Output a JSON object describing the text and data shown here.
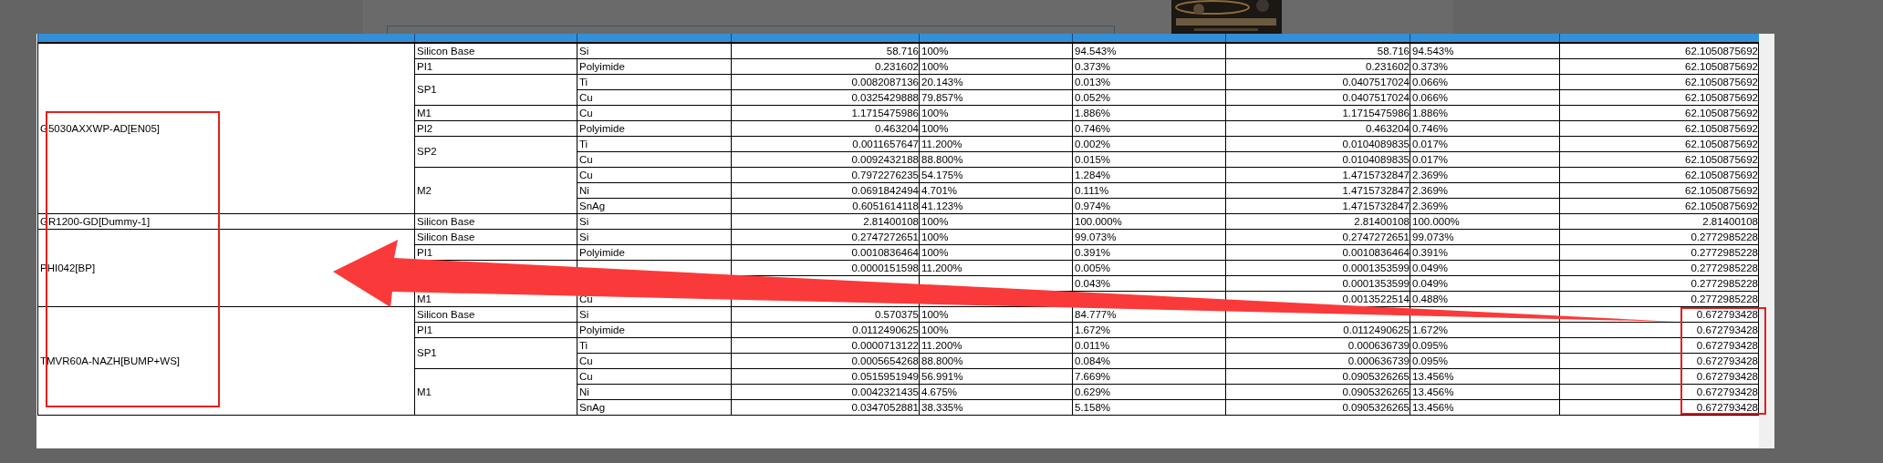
{
  "table": {
    "groups": [
      {
        "name": "G5030AXXWP-AD[EN05]",
        "layers": [
          {
            "layer": "Silicon Base",
            "materials": [
              {
                "material": "Si",
                "column_4": "58.716",
                "column_5": "100%",
                "column_6": "94.543%",
                "column_7": "58.716",
                "column_8": "94.543%",
                "column_9": "62.1050875692"
              }
            ]
          },
          {
            "layer": "PI1",
            "materials": [
              {
                "material": "Polyimide",
                "column_4": "0.231602",
                "column_5": "100%",
                "column_6": "0.373%",
                "column_7": "0.231602",
                "column_8": "0.373%",
                "column_9": "62.1050875692"
              }
            ]
          },
          {
            "layer": "SP1",
            "materials": [
              {
                "material": "Ti",
                "column_4": "0.0082087136",
                "column_5": "20.143%",
                "column_6": "0.013%",
                "column_7": "0.0407517024",
                "column_8": "0.066%",
                "column_9": "62.1050875692"
              },
              {
                "material": "Cu",
                "column_4": "0.0325429888",
                "column_5": "79.857%",
                "column_6": "0.052%",
                "column_7": "0.0407517024",
                "column_8": "0.066%",
                "column_9": "62.1050875692"
              }
            ]
          },
          {
            "layer": "M1",
            "materials": [
              {
                "material": "Cu",
                "column_4": "1.1715475986",
                "column_5": "100%",
                "column_6": "1.886%",
                "column_7": "1.1715475986",
                "column_8": "1.886%",
                "column_9": "62.1050875692"
              }
            ]
          },
          {
            "layer": "PI2",
            "materials": [
              {
                "material": "Polyimide",
                "column_4": "0.463204",
                "column_5": "100%",
                "column_6": "0.746%",
                "column_7": "0.463204",
                "column_8": "0.746%",
                "column_9": "62.1050875692"
              }
            ]
          },
          {
            "layer": "SP2",
            "materials": [
              {
                "material": "Ti",
                "column_4": "0.0011657647",
                "column_5": "11.200%",
                "column_6": "0.002%",
                "column_7": "0.0104089835",
                "column_8": "0.017%",
                "column_9": "62.1050875692"
              },
              {
                "material": "Cu",
                "column_4": "0.0092432188",
                "column_5": "88.800%",
                "column_6": "0.015%",
                "column_7": "0.0104089835",
                "column_8": "0.017%",
                "column_9": "62.1050875692"
              }
            ]
          },
          {
            "layer": "M2",
            "materials": [
              {
                "material": "Cu",
                "column_4": "0.7972276235",
                "column_5": "54.175%",
                "column_6": "1.284%",
                "column_7": "1.4715732847",
                "column_8": "2.369%",
                "column_9": "62.1050875692"
              },
              {
                "material": "Ni",
                "column_4": "0.0691842494",
                "column_5": "4.701%",
                "column_6": "0.111%",
                "column_7": "1.4715732847",
                "column_8": "2.369%",
                "column_9": "62.1050875692"
              },
              {
                "material": "SnAg",
                "column_4": "0.6051614118",
                "column_5": "41.123%",
                "column_6": "0.974%",
                "column_7": "1.4715732847",
                "column_8": "2.369%",
                "column_9": "62.1050875692"
              }
            ]
          }
        ]
      },
      {
        "name": "GR1200-GD[Dummy-1]",
        "layers": [
          {
            "layer": "Silicon Base",
            "materials": [
              {
                "material": "Si",
                "column_4": "2.81400108",
                "column_5": "100%",
                "column_6": "100.000%",
                "column_7": "2.81400108",
                "column_8": "100.000%",
                "column_9": "2.81400108"
              }
            ]
          }
        ]
      },
      {
        "name": "PHI042[BP]",
        "layers": [
          {
            "layer": "Silicon Base",
            "materials": [
              {
                "material": "Si",
                "column_4": "0.2747272651",
                "column_5": "100%",
                "column_6": "99.073%",
                "column_7": "0.2747272651",
                "column_8": "99.073%",
                "column_9": "0.2772985228"
              }
            ]
          },
          {
            "layer": "PI1",
            "materials": [
              {
                "material": "Polyimide",
                "column_4": "0.0010836464",
                "column_5": "100%",
                "column_6": "0.391%",
                "column_7": "0.0010836464",
                "column_8": "0.391%",
                "column_9": "0.2772985228"
              }
            ]
          },
          {
            "materials": [
              {
                "column_4": "0.0000151598",
                "column_5": "11.200%",
                "column_6": "0.005%",
                "column_7": "0.0001353599",
                "column_8": "0.049%",
                "column_9": "0.2772985228"
              },
              {
                "column_6": "0.043%",
                "column_7": "0.0001353599",
                "column_8": "0.049%",
                "column_9": "0.2772985228"
              }
            ]
          },
          {
            "layer": "M1",
            "materials": [
              {
                "material": "Cu",
                "column_7": "0.0013522514",
                "column_8": "0.488%",
                "column_9": "0.2772985228"
              }
            ]
          }
        ]
      },
      {
        "name": "TMVR60A-NAZH[BUMP+WS]",
        "layers": [
          {
            "layer": "Silicon Base",
            "materials": [
              {
                "material": "Si",
                "column_4": "0.570375",
                "column_5": "100%",
                "column_6": "84.777%",
                "column_9": "0.672793428"
              }
            ]
          },
          {
            "layer": "PI1",
            "materials": [
              {
                "material": "Polyimide",
                "column_4": "0.0112490625",
                "column_5": "100%",
                "column_6": "1.672%",
                "column_7": "0.0112490625",
                "column_8": "1.672%",
                "column_9": "0.672793428"
              }
            ]
          },
          {
            "layer": "SP1",
            "materials": [
              {
                "material": "Ti",
                "column_4": "0.0000713122",
                "column_5": "11.200%",
                "column_6": "0.011%",
                "column_7": "0.000636739",
                "column_8": "0.095%",
                "column_9": "0.672793428"
              },
              {
                "material": "Cu",
                "column_4": "0.0005654268",
                "column_5": "88.800%",
                "column_6": "0.084%",
                "column_7": "0.000636739",
                "column_8": "0.095%",
                "column_9": "0.672793428"
              }
            ]
          },
          {
            "layer": "M1",
            "materials": [
              {
                "material": "Cu",
                "column_4": "0.0515951949",
                "column_5": "56.991%",
                "column_6": "7.669%",
                "column_7": "0.0905326265",
                "column_8": "13.456%",
                "column_9": "0.672793428"
              },
              {
                "material": "Ni",
                "column_4": "0.0042321435",
                "column_5": "4.675%",
                "column_6": "0.629%",
                "column_7": "0.0905326265",
                "column_8": "13.456%",
                "column_9": "0.672793428"
              },
              {
                "material": "SnAg",
                "column_4": "0.0347052881",
                "column_5": "38.335%",
                "column_6": "5.158%",
                "column_7": "0.0905326265",
                "column_8": "13.456%",
                "column_9": "0.672793428"
              }
            ]
          }
        ]
      }
    ]
  }
}
